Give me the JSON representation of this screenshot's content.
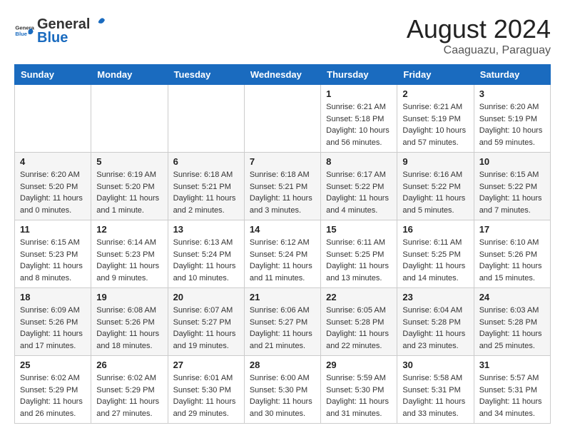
{
  "header": {
    "logo_general": "General",
    "logo_blue": "Blue",
    "month_year": "August 2024",
    "location": "Caaguazu, Paraguay"
  },
  "weekdays": [
    "Sunday",
    "Monday",
    "Tuesday",
    "Wednesday",
    "Thursday",
    "Friday",
    "Saturday"
  ],
  "weeks": [
    [
      {
        "day": "",
        "sunrise": "",
        "sunset": "",
        "daylight": ""
      },
      {
        "day": "",
        "sunrise": "",
        "sunset": "",
        "daylight": ""
      },
      {
        "day": "",
        "sunrise": "",
        "sunset": "",
        "daylight": ""
      },
      {
        "day": "",
        "sunrise": "",
        "sunset": "",
        "daylight": ""
      },
      {
        "day": "1",
        "sunrise": "6:21 AM",
        "sunset": "5:18 PM",
        "daylight": "10 hours and 56 minutes."
      },
      {
        "day": "2",
        "sunrise": "6:21 AM",
        "sunset": "5:19 PM",
        "daylight": "10 hours and 57 minutes."
      },
      {
        "day": "3",
        "sunrise": "6:20 AM",
        "sunset": "5:19 PM",
        "daylight": "10 hours and 59 minutes."
      }
    ],
    [
      {
        "day": "4",
        "sunrise": "6:20 AM",
        "sunset": "5:20 PM",
        "daylight": "11 hours and 0 minutes."
      },
      {
        "day": "5",
        "sunrise": "6:19 AM",
        "sunset": "5:20 PM",
        "daylight": "11 hours and 1 minute."
      },
      {
        "day": "6",
        "sunrise": "6:18 AM",
        "sunset": "5:21 PM",
        "daylight": "11 hours and 2 minutes."
      },
      {
        "day": "7",
        "sunrise": "6:18 AM",
        "sunset": "5:21 PM",
        "daylight": "11 hours and 3 minutes."
      },
      {
        "day": "8",
        "sunrise": "6:17 AM",
        "sunset": "5:22 PM",
        "daylight": "11 hours and 4 minutes."
      },
      {
        "day": "9",
        "sunrise": "6:16 AM",
        "sunset": "5:22 PM",
        "daylight": "11 hours and 5 minutes."
      },
      {
        "day": "10",
        "sunrise": "6:15 AM",
        "sunset": "5:22 PM",
        "daylight": "11 hours and 7 minutes."
      }
    ],
    [
      {
        "day": "11",
        "sunrise": "6:15 AM",
        "sunset": "5:23 PM",
        "daylight": "11 hours and 8 minutes."
      },
      {
        "day": "12",
        "sunrise": "6:14 AM",
        "sunset": "5:23 PM",
        "daylight": "11 hours and 9 minutes."
      },
      {
        "day": "13",
        "sunrise": "6:13 AM",
        "sunset": "5:24 PM",
        "daylight": "11 hours and 10 minutes."
      },
      {
        "day": "14",
        "sunrise": "6:12 AM",
        "sunset": "5:24 PM",
        "daylight": "11 hours and 11 minutes."
      },
      {
        "day": "15",
        "sunrise": "6:11 AM",
        "sunset": "5:25 PM",
        "daylight": "11 hours and 13 minutes."
      },
      {
        "day": "16",
        "sunrise": "6:11 AM",
        "sunset": "5:25 PM",
        "daylight": "11 hours and 14 minutes."
      },
      {
        "day": "17",
        "sunrise": "6:10 AM",
        "sunset": "5:26 PM",
        "daylight": "11 hours and 15 minutes."
      }
    ],
    [
      {
        "day": "18",
        "sunrise": "6:09 AM",
        "sunset": "5:26 PM",
        "daylight": "11 hours and 17 minutes."
      },
      {
        "day": "19",
        "sunrise": "6:08 AM",
        "sunset": "5:26 PM",
        "daylight": "11 hours and 18 minutes."
      },
      {
        "day": "20",
        "sunrise": "6:07 AM",
        "sunset": "5:27 PM",
        "daylight": "11 hours and 19 minutes."
      },
      {
        "day": "21",
        "sunrise": "6:06 AM",
        "sunset": "5:27 PM",
        "daylight": "11 hours and 21 minutes."
      },
      {
        "day": "22",
        "sunrise": "6:05 AM",
        "sunset": "5:28 PM",
        "daylight": "11 hours and 22 minutes."
      },
      {
        "day": "23",
        "sunrise": "6:04 AM",
        "sunset": "5:28 PM",
        "daylight": "11 hours and 23 minutes."
      },
      {
        "day": "24",
        "sunrise": "6:03 AM",
        "sunset": "5:28 PM",
        "daylight": "11 hours and 25 minutes."
      }
    ],
    [
      {
        "day": "25",
        "sunrise": "6:02 AM",
        "sunset": "5:29 PM",
        "daylight": "11 hours and 26 minutes."
      },
      {
        "day": "26",
        "sunrise": "6:02 AM",
        "sunset": "5:29 PM",
        "daylight": "11 hours and 27 minutes."
      },
      {
        "day": "27",
        "sunrise": "6:01 AM",
        "sunset": "5:30 PM",
        "daylight": "11 hours and 29 minutes."
      },
      {
        "day": "28",
        "sunrise": "6:00 AM",
        "sunset": "5:30 PM",
        "daylight": "11 hours and 30 minutes."
      },
      {
        "day": "29",
        "sunrise": "5:59 AM",
        "sunset": "5:30 PM",
        "daylight": "11 hours and 31 minutes."
      },
      {
        "day": "30",
        "sunrise": "5:58 AM",
        "sunset": "5:31 PM",
        "daylight": "11 hours and 33 minutes."
      },
      {
        "day": "31",
        "sunrise": "5:57 AM",
        "sunset": "5:31 PM",
        "daylight": "11 hours and 34 minutes."
      }
    ]
  ],
  "labels": {
    "sunrise_prefix": "Sunrise: ",
    "sunset_prefix": "Sunset: ",
    "daylight_prefix": "Daylight: "
  }
}
